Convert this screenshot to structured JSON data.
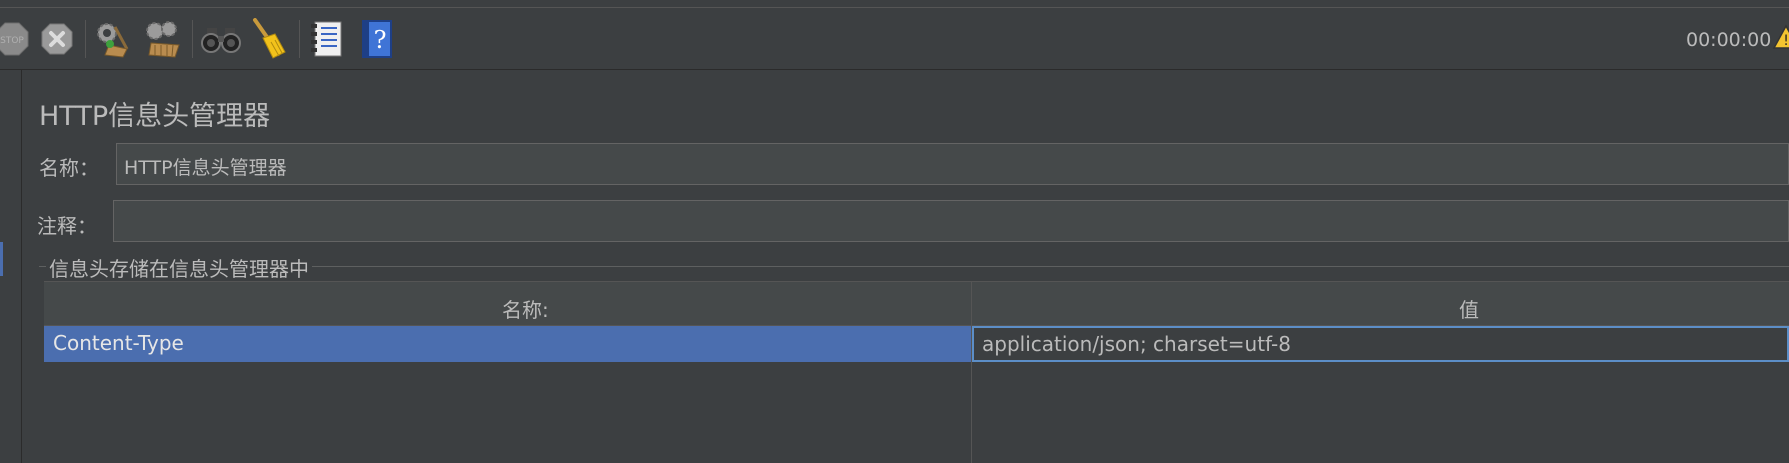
{
  "toolbar": {
    "buttons": [
      {
        "name": "stop",
        "icon": "stop-icon"
      },
      {
        "name": "shutdown",
        "icon": "shutdown-icon"
      },
      {
        "name": "clear",
        "icon": "broom-gear-icon"
      },
      {
        "name": "clear-all",
        "icon": "broom-gear-all-icon"
      },
      {
        "name": "search",
        "icon": "binoculars-icon"
      },
      {
        "name": "reset-search",
        "icon": "broom-icon"
      },
      {
        "name": "function-helper",
        "icon": "list-icon"
      },
      {
        "name": "help",
        "icon": "help-book-icon"
      }
    ],
    "timer": "00:00:00"
  },
  "panel": {
    "title": "HTTP信息头管理器",
    "name_label": "名称：",
    "name_value": "HTTP信息头管理器",
    "comment_label": "注释：",
    "comment_value": "",
    "group_title": "信息头存储在信息头管理器中"
  },
  "table": {
    "columns": [
      "名称:",
      "值"
    ],
    "rows": [
      {
        "name": "Content-Type",
        "value": "application/json; charset=utf-8"
      }
    ]
  },
  "colors": {
    "background": "#3c3f41",
    "selection": "#4b6eaf",
    "focus_border": "#5c8ec7"
  }
}
